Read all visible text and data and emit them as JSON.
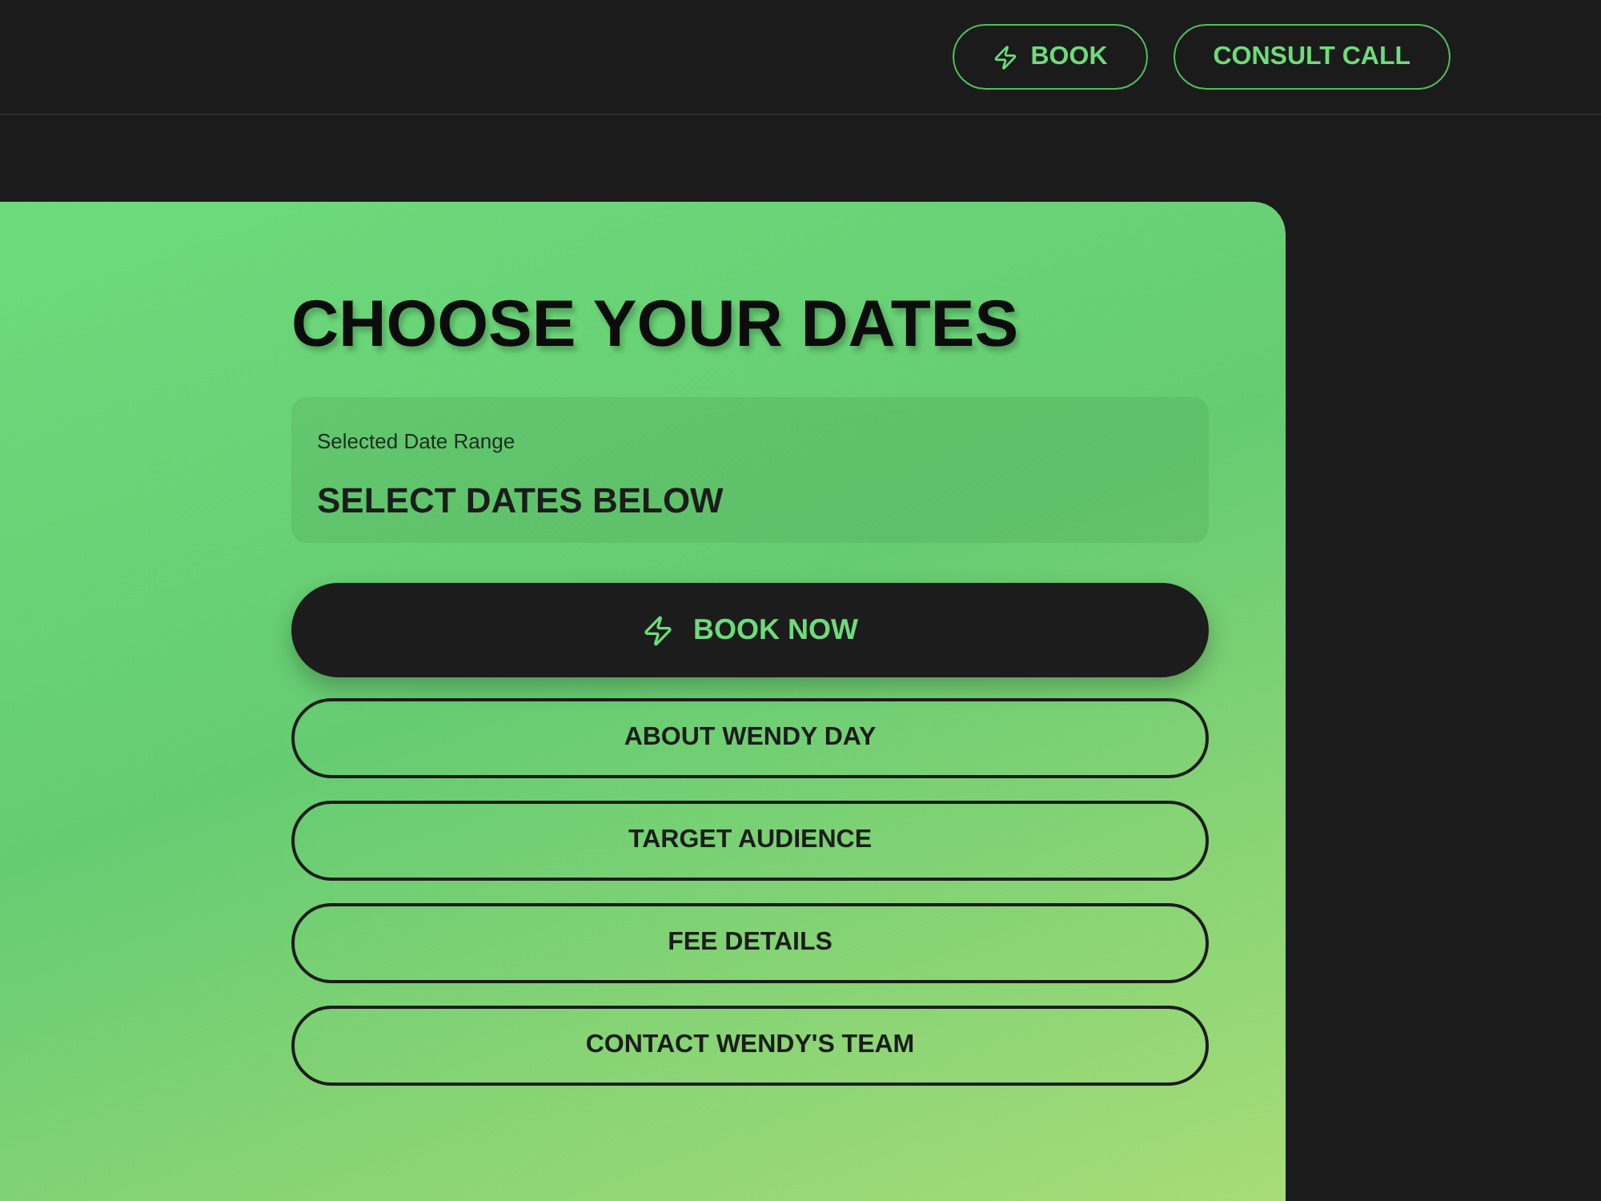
{
  "header": {
    "buttons": [
      {
        "label": "BOOK",
        "kind": "icon"
      },
      {
        "label": "CONSULT CALL",
        "kind": "plain"
      }
    ]
  },
  "booking_card": {
    "title": "CHOOSE YOUR DATES",
    "date_range": {
      "label": "Selected Date Range",
      "value": "SELECT DATES BELOW"
    },
    "primary_button": {
      "label": "BOOK NOW"
    },
    "menu_buttons": [
      "ABOUT WENDY DAY",
      "TARGET AUDIENCE",
      "FEE DETAILS",
      "CONTACT WENDY'S TEAM"
    ]
  }
}
